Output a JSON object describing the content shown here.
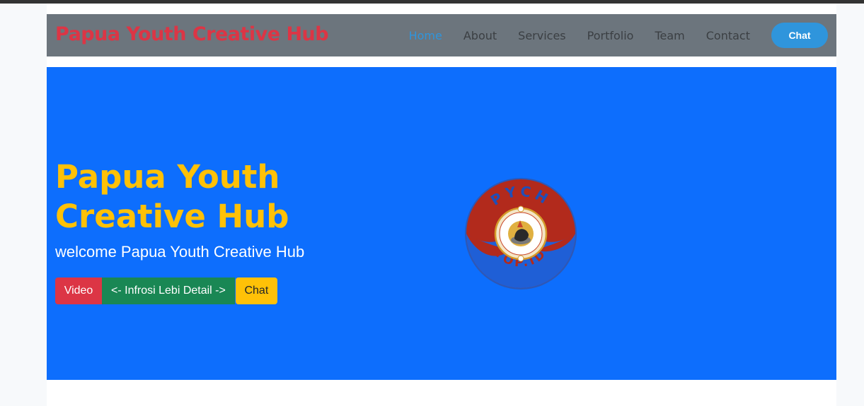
{
  "navbar": {
    "brand": "Papua Youth Creative Hub",
    "links": [
      {
        "label": "Home",
        "active": true
      },
      {
        "label": "About"
      },
      {
        "label": "Services"
      },
      {
        "label": "Portfolio"
      },
      {
        "label": "Team"
      },
      {
        "label": "Contact"
      }
    ],
    "chat_label": "Chat"
  },
  "hero": {
    "title": "Papua Youth Creative Hub",
    "subtitle": "welcome Papua Youth Creative Hub",
    "buttons": {
      "video": "Video",
      "info": "<- Infrosi Lebi Detail ->",
      "chat": "Chat"
    },
    "logo": {
      "top_text": "PYCH",
      "bottom_text": "TOP.ID",
      "icon": "pych-logo-emblem"
    }
  },
  "colors": {
    "hero_background": "#0d6efd",
    "navbar_background": "#6c757d",
    "brand": "#dc3545",
    "title": "#ffc107",
    "nav_active": "#2f95dc"
  }
}
